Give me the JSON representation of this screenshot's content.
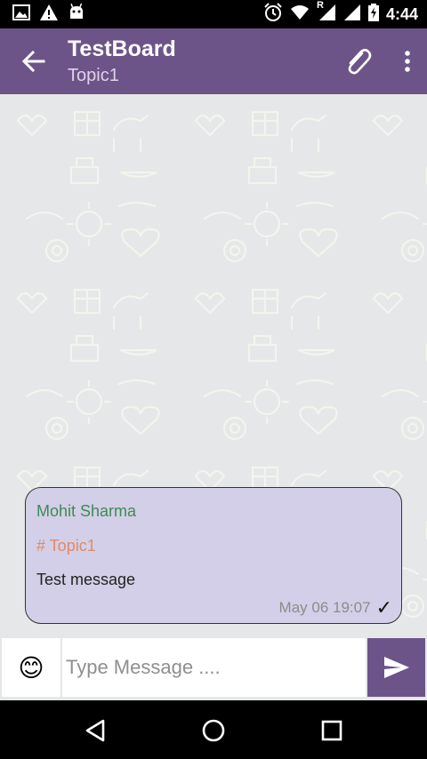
{
  "status_bar": {
    "time": "4:44",
    "icons": [
      "image-icon",
      "warning-icon",
      "android-icon",
      "alarm-icon",
      "wifi-icon",
      "signal-roaming-icon",
      "signal-icon",
      "battery-charging-icon"
    ],
    "roaming_label": "R"
  },
  "header": {
    "title": "TestBoard",
    "subtitle": "Topic1",
    "accent_color": "#6d5488"
  },
  "messages": [
    {
      "sender": "Mohit Sharma",
      "topic": "# Topic1",
      "text": "Test message",
      "timestamp": "May 06 19:07",
      "status": "✓",
      "bubble_color": "#d3cfe8",
      "sender_color": "#3e8a55",
      "topic_color": "#e08a65"
    }
  ],
  "composer": {
    "emoji": "😊",
    "placeholder": "Type Message ...."
  },
  "nav": [
    "back-icon",
    "home-icon",
    "recents-icon"
  ]
}
